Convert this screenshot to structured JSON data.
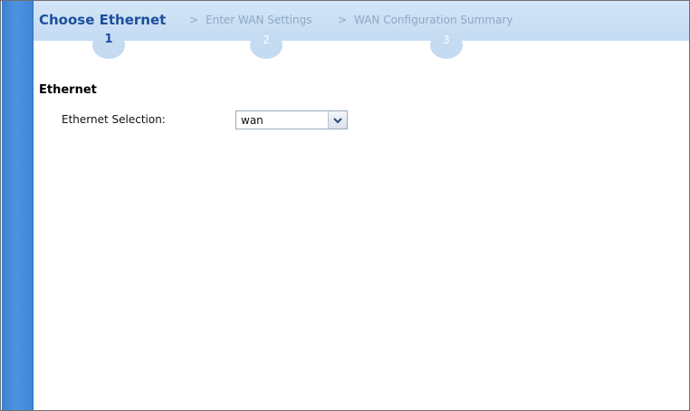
{
  "wizard": {
    "steps": [
      {
        "label": "Choose Ethernet",
        "number": "1",
        "active": true
      },
      {
        "label": "Enter WAN Settings",
        "number": "2",
        "active": false
      },
      {
        "label": "WAN Configuration Summary",
        "number": "3",
        "active": false
      }
    ],
    "separator": ">"
  },
  "section": {
    "title": "Ethernet"
  },
  "form": {
    "ethernet_selection_label": "Ethernet Selection:",
    "ethernet_selection_value": "wan"
  },
  "colors": {
    "sidebar_blue": "#3f86d8",
    "wizard_bar": "#c4dbf2",
    "active_step": "#1c4f9c",
    "inactive_step": "#8ea7c4"
  },
  "icons": {
    "dropdown": "chevron-down-icon"
  }
}
